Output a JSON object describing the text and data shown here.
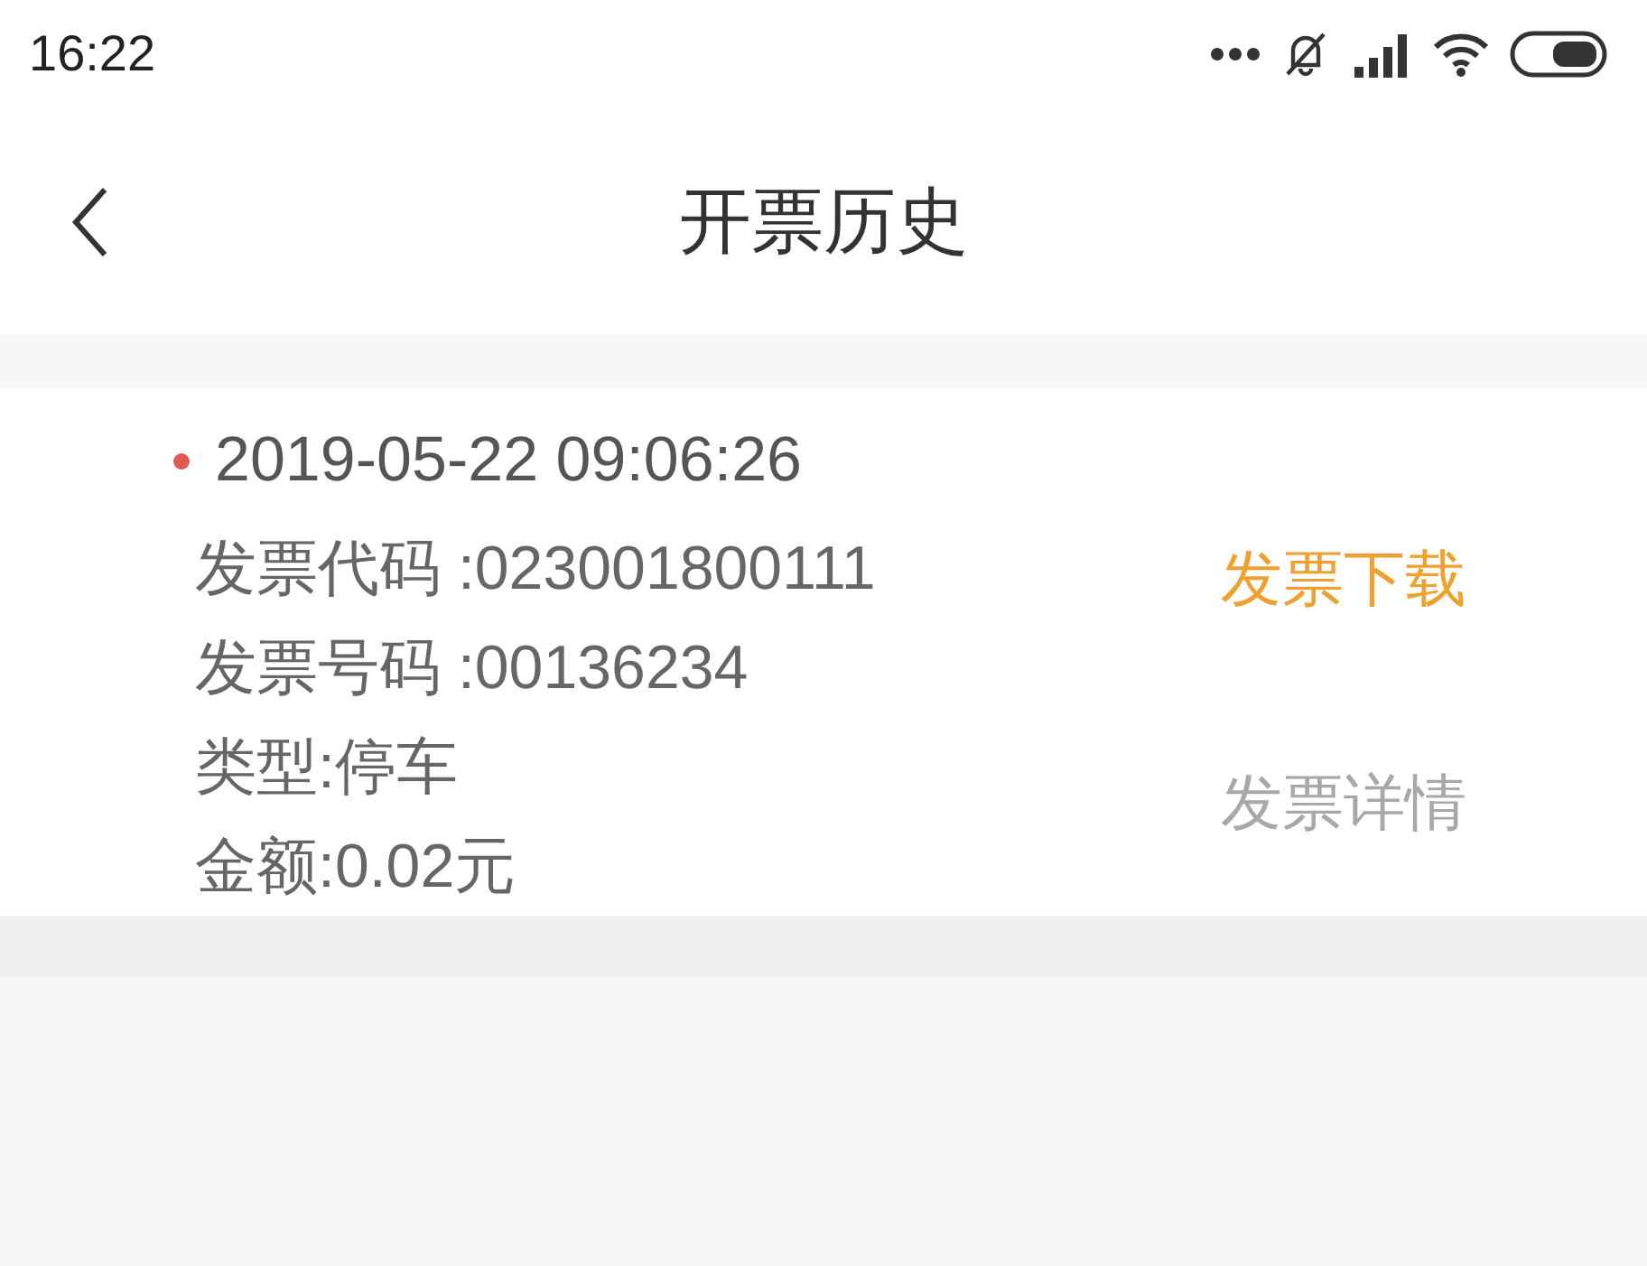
{
  "status_bar": {
    "time": "16:22"
  },
  "header": {
    "title": "开票历史"
  },
  "records": [
    {
      "datetime": "2019-05-22 09:06:26",
      "fields": [
        "发票代码 :023001800111",
        "发票号码 :00136234",
        "类型:停车",
        "金额:0.02元"
      ],
      "actions": [
        {
          "label": "发票下载",
          "kind": "primary"
        },
        {
          "label": "发票详情",
          "kind": "secondary"
        }
      ]
    }
  ]
}
